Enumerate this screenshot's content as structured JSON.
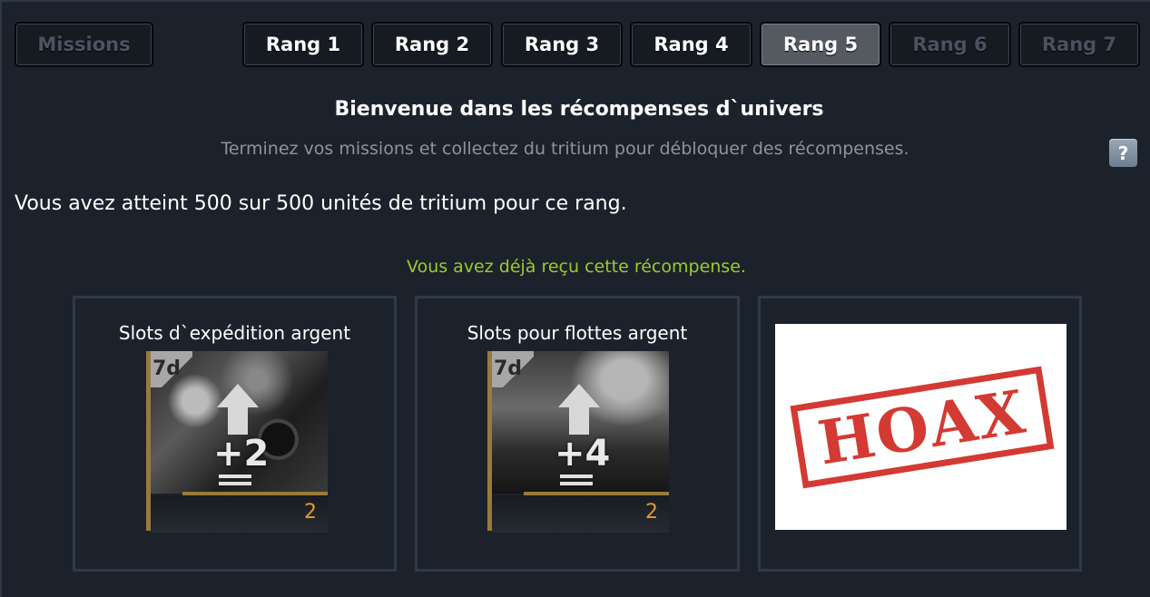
{
  "tabs": {
    "missions": "Missions",
    "ranks": [
      "Rang 1",
      "Rang 2",
      "Rang 3",
      "Rang 4",
      "Rang 5",
      "Rang 6",
      "Rang 7"
    ],
    "active_rank": "Rang 5"
  },
  "header": {
    "title": "Bienvenue dans les récompenses d`univers",
    "subtitle": "Terminez vos missions et collectez du tritium pour débloquer des récompenses.",
    "help_label": "?"
  },
  "progress_text": "Vous avez atteint 500 sur 500 unités de tritium pour ce rang.",
  "status_text": "Vous avez déjà reçu cette récompense.",
  "rewards": [
    {
      "label": "Slots d`expédition argent",
      "duration": "7d",
      "bonus": "+2",
      "count": "2",
      "icon": "expedition-slots-icon"
    },
    {
      "label": "Slots pour flottes argent",
      "duration": "7d",
      "bonus": "+4",
      "count": "2",
      "icon": "fleet-slots-icon"
    },
    {
      "label": "",
      "stamp": "HOAX"
    }
  ],
  "colors": {
    "background": "#1c222c",
    "status_green": "#9bcb2d",
    "count_orange": "#e69a2e",
    "stamp_red": "#d33a33"
  }
}
